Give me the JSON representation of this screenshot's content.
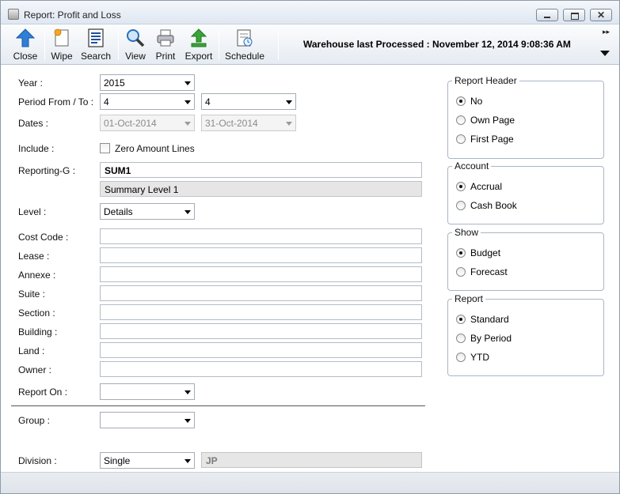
{
  "window": {
    "title": "Report: Profit and Loss",
    "close_glyph": "✕"
  },
  "toolbar": {
    "buttons": [
      {
        "label": "Close",
        "icon": "arrow-up-icon"
      },
      {
        "label": "Wipe",
        "icon": "wipe-document-icon"
      },
      {
        "label": "Search",
        "icon": "search-document-icon"
      },
      {
        "label": "View",
        "icon": "magnifier-icon"
      },
      {
        "label": "Print",
        "icon": "printer-icon"
      },
      {
        "label": "Export",
        "icon": "export-arrow-icon"
      },
      {
        "label": "Schedule",
        "icon": "schedule-icon"
      }
    ],
    "warehouse_text": "Warehouse last Processed : November 12, 2014 9:08:36 AM",
    "more_glyph": "▸▸"
  },
  "form": {
    "year_label": "Year :",
    "year_value": "2015",
    "period_label": "Period From / To :",
    "period_from": "4",
    "period_to": "4",
    "dates_label": "Dates :",
    "date_from": "01-Oct-2014",
    "date_to": "31-Oct-2014",
    "include_label": "Include :",
    "zero_amount_label": "Zero Amount Lines",
    "reporting_label": "Reporting-G :",
    "reporting_code": "SUM1",
    "reporting_desc": "Summary Level 1",
    "level_label": "Level :",
    "level_value": "Details",
    "cost_code_label": "Cost Code :",
    "lease_label": "Lease :",
    "annexe_label": "Annexe :",
    "suite_label": "Suite :",
    "section_label": "Section :",
    "building_label": "Building :",
    "land_label": "Land :",
    "owner_label": "Owner :",
    "report_on_label": "Report On :",
    "report_on_value": "",
    "group_label": "Group :",
    "group_value": "",
    "division_label": "Division :",
    "division_value": "Single",
    "division_code": "JP"
  },
  "panels": {
    "report_header": {
      "title": "Report Header",
      "options": [
        "No",
        "Own Page",
        "First Page"
      ],
      "selected": "No"
    },
    "account": {
      "title": "Account",
      "options": [
        "Accrual",
        "Cash Book"
      ],
      "selected": "Accrual"
    },
    "show": {
      "title": "Show",
      "options": [
        "Budget",
        "Forecast"
      ],
      "selected": "Budget"
    },
    "report": {
      "title": "Report",
      "options": [
        "Standard",
        "By Period",
        "YTD"
      ],
      "selected": "Standard"
    }
  },
  "colors": {
    "accent_blue": "#2f7fd6",
    "export_green": "#3aa33a",
    "window_border": "#8e9bab"
  }
}
